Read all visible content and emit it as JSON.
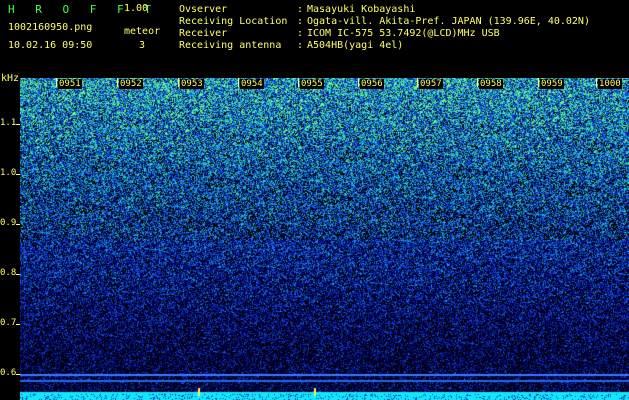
{
  "header": {
    "app_title": "H R O F F T",
    "app_version": "1.00",
    "file_name": "1002160950.png",
    "date_time": "10.02.16 09:50",
    "meteor_label": "meteor",
    "meteor_count": "3"
  },
  "info": [
    {
      "key": "Ovserver",
      "value": "Masayuki Kobayashi"
    },
    {
      "key": "Receiving Location",
      "value": "Ogata-vill. Akita-Pref. JAPAN (139.96E, 40.02N)"
    },
    {
      "key": "Receiver",
      "value": "ICOM IC-575 53.7492(@LCD)MHz USB"
    },
    {
      "key": "Receiving antenna",
      "value": "A504HB(yagi 4el)"
    }
  ],
  "axis": {
    "unit": "kHz",
    "y_ticks": [
      "1.1",
      "1.0",
      "0.9",
      "0.8",
      "0.7",
      "0.6"
    ],
    "time_ticks": [
      "0951",
      "0952",
      "0953",
      "0954",
      "0955",
      "0956",
      "0957",
      "0958",
      "0959",
      "1000"
    ]
  },
  "colors": {
    "text": "#ffff66",
    "title": "#44ff44",
    "background": "#000000",
    "noise_high": "#33ff99",
    "noise_low": "#0000aa",
    "baseline": "#00ffff"
  }
}
